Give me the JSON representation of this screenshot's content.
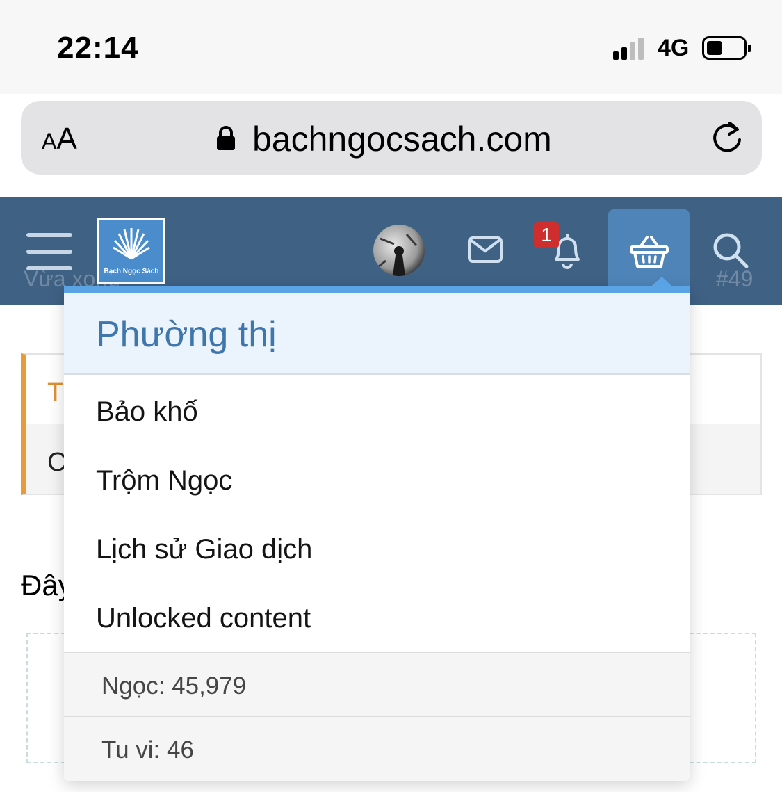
{
  "status_bar": {
    "time": "22:14",
    "network": "4G",
    "battery_level": 0.35
  },
  "address_bar": {
    "text_size_label": "AA",
    "url": "bachngocsach.com",
    "icons": [
      "lock-icon",
      "reload-icon"
    ]
  },
  "header": {
    "logo_text": "Bạch Ngọc Sách",
    "notification_count": "1",
    "icons": [
      "menu-icon",
      "avatar",
      "mail-icon",
      "bell-icon",
      "basket-icon",
      "search-icon"
    ],
    "colors": {
      "header_bg": "#3f6184",
      "active_tab": "#4f84b8"
    }
  },
  "background_page": {
    "behind_left_text": "Vừa xong",
    "behind_right_text": "#49",
    "notice_first_letter": "T",
    "notice_second_letter": "C",
    "heading_fragment": "Đây"
  },
  "dropdown": {
    "title": "Phường thị",
    "items": [
      {
        "label": "Bảo khố"
      },
      {
        "label": "Trộm Ngọc"
      },
      {
        "label": "Lịch sử Giao dịch"
      },
      {
        "label": "Unlocked content"
      }
    ],
    "stats": {
      "ngoc": "Ngọc: 45,979",
      "tu_vi": "Tu vi: 46"
    },
    "colors": {
      "accent": "#5aa4e6",
      "title": "#3f77ad",
      "title_bg": "#ebf3fc"
    }
  }
}
